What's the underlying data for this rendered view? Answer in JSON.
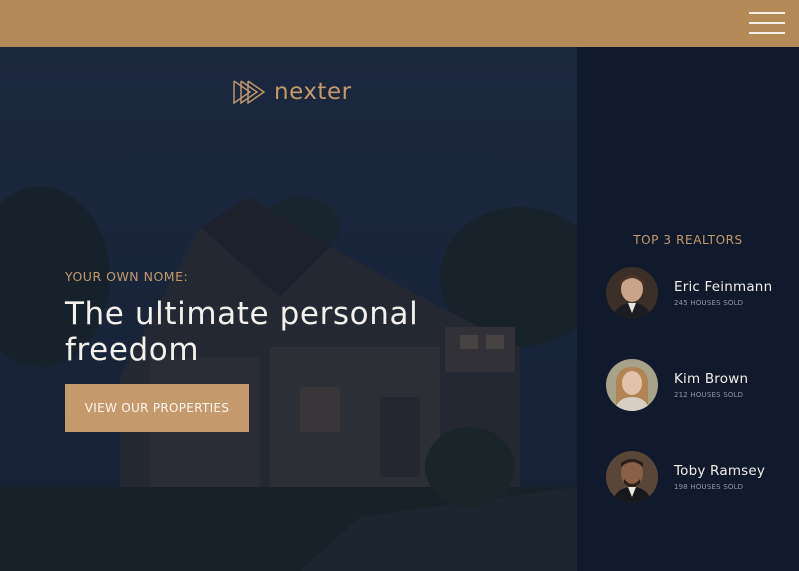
{
  "header": {
    "menu_icon": "hamburger-menu-icon",
    "bar_color": "#b38a58"
  },
  "logo": {
    "icon": "triple-play-arrow-icon",
    "text": "nexter"
  },
  "hero": {
    "eyebrow": "YOUR OWN NOME:",
    "headline_line1": "The ultimate personal",
    "headline_line2": "freedom",
    "cta_label": "VIEW OUR PROPERTIES",
    "accent_color": "#c49a6c"
  },
  "realtors": {
    "title": "TOP 3 REALTORS",
    "items": [
      {
        "name": "Eric Feinmann",
        "sold": "245 HOUSES SOLD"
      },
      {
        "name": "Kim Brown",
        "sold": "212 HOUSES SOLD"
      },
      {
        "name": "Toby Ramsey",
        "sold": "198 HOUSES SOLD"
      }
    ]
  }
}
